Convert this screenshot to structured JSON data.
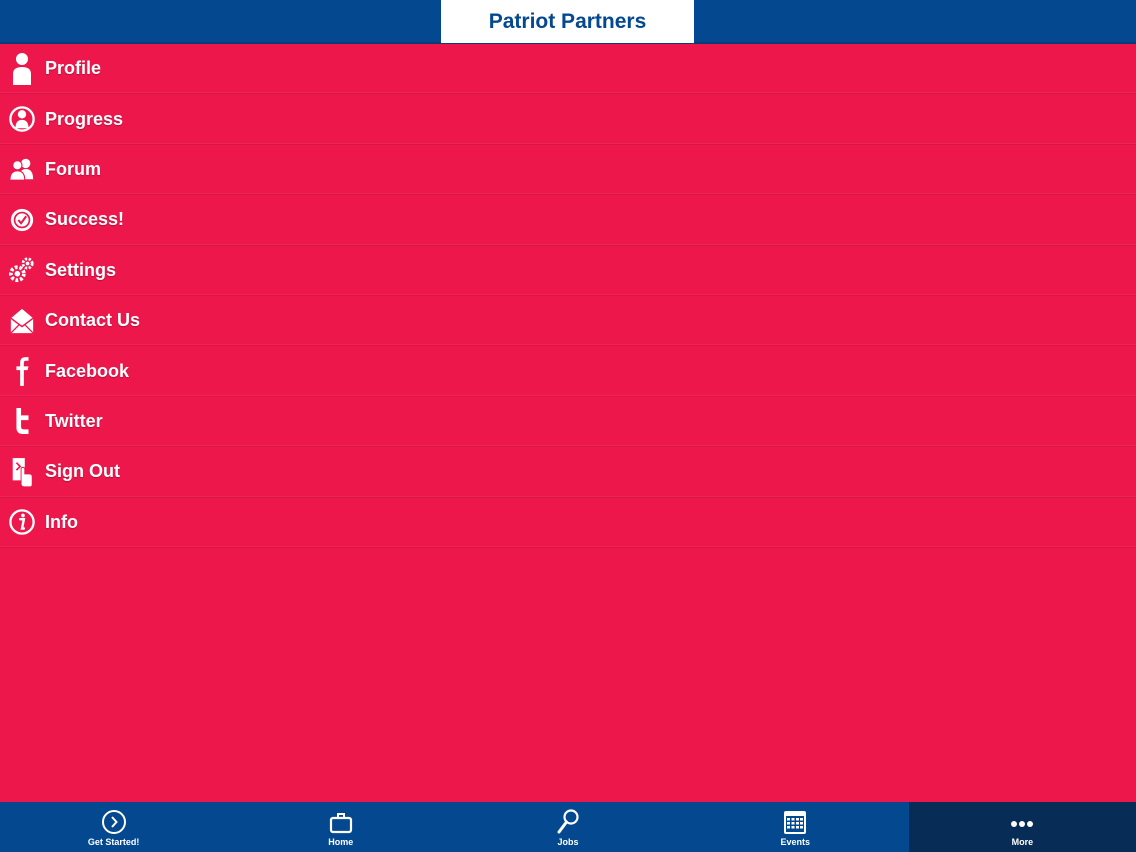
{
  "header": {
    "title": "Patriot Partners"
  },
  "colors": {
    "header_blue": "#04488F",
    "menu_red": "#ED174C",
    "tab_active": "#072C55",
    "text_white": "#FFFFFF"
  },
  "menu": {
    "items": [
      {
        "label": "Profile",
        "icon": "person-icon"
      },
      {
        "label": "Progress",
        "icon": "progress-person-icon"
      },
      {
        "label": "Forum",
        "icon": "users-icon"
      },
      {
        "label": "Success!",
        "icon": "badge-check-icon"
      },
      {
        "label": "Settings",
        "icon": "gears-icon"
      },
      {
        "label": "Contact Us",
        "icon": "envelope-icon"
      },
      {
        "label": "Facebook",
        "icon": "facebook-icon"
      },
      {
        "label": "Twitter",
        "icon": "twitter-icon"
      },
      {
        "label": "Sign Out",
        "icon": "sign-out-icon"
      },
      {
        "label": "Info",
        "icon": "info-icon"
      }
    ]
  },
  "tabs": [
    {
      "label": "Get Started!",
      "icon": "play-circle-icon",
      "active": false
    },
    {
      "label": "Home",
      "icon": "briefcase-icon",
      "active": false
    },
    {
      "label": "Jobs",
      "icon": "magnifier-icon",
      "active": false
    },
    {
      "label": "Events",
      "icon": "calendar-icon",
      "active": false
    },
    {
      "label": "More",
      "icon": "more-dots-icon",
      "active": true
    }
  ]
}
